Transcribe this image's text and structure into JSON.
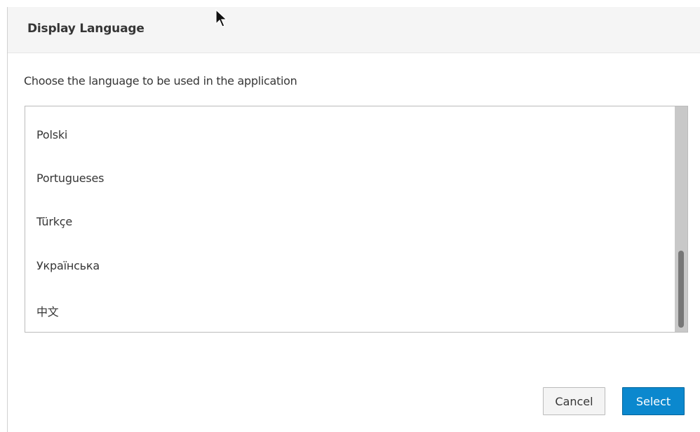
{
  "dialog": {
    "title": "Display Language",
    "description": "Choose the language to be used in the application"
  },
  "language_list": {
    "items": [
      "Polski",
      "Portugueses",
      "Türkçe",
      "Українська",
      "中文"
    ],
    "scroll_position": 0.82
  },
  "buttons": {
    "cancel_label": "Cancel",
    "select_label": "Select"
  },
  "colors": {
    "primary": "#0b88ce",
    "header_bg": "#f5f5f5"
  },
  "icons": {
    "cursor": "mouse-pointer-icon"
  }
}
